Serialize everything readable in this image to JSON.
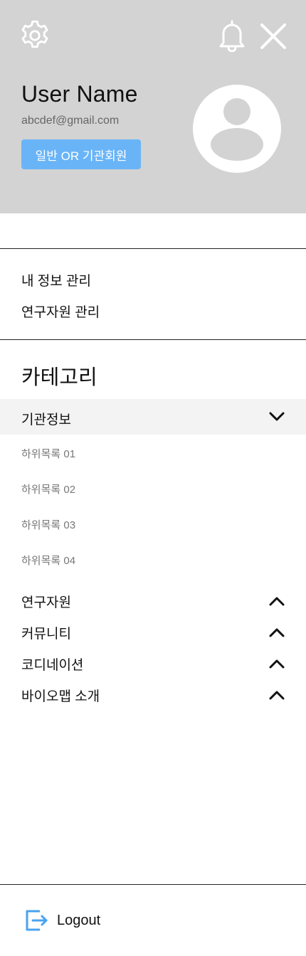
{
  "header": {
    "user_name": "User Name",
    "email": "abcdef@gmail.com",
    "member_type": "일반 OR 기관회원",
    "icons": {
      "settings": "gear-icon",
      "notifications": "bell-icon",
      "close": "close-icon",
      "avatar": "user-avatar-icon"
    },
    "badge_color": "#69b4f7",
    "background_color": "#d3d3d3"
  },
  "account_menu": [
    {
      "label": "내 정보 관리"
    },
    {
      "label": "연구자원 관리"
    }
  ],
  "category": {
    "title": "카테고리",
    "expanded": {
      "label": "기관정보",
      "subitems": [
        "하위목록 01",
        "하위목록 02",
        "하위목록 03",
        "하위목록 04"
      ]
    },
    "collapsed": [
      {
        "label": "연구자원"
      },
      {
        "label": "커뮤니티"
      },
      {
        "label": "코디네이션"
      },
      {
        "label": "바이오맵 소개"
      }
    ]
  },
  "footer": {
    "logout_label": "Logout",
    "logout_icon_color": "#4aa3f0"
  }
}
